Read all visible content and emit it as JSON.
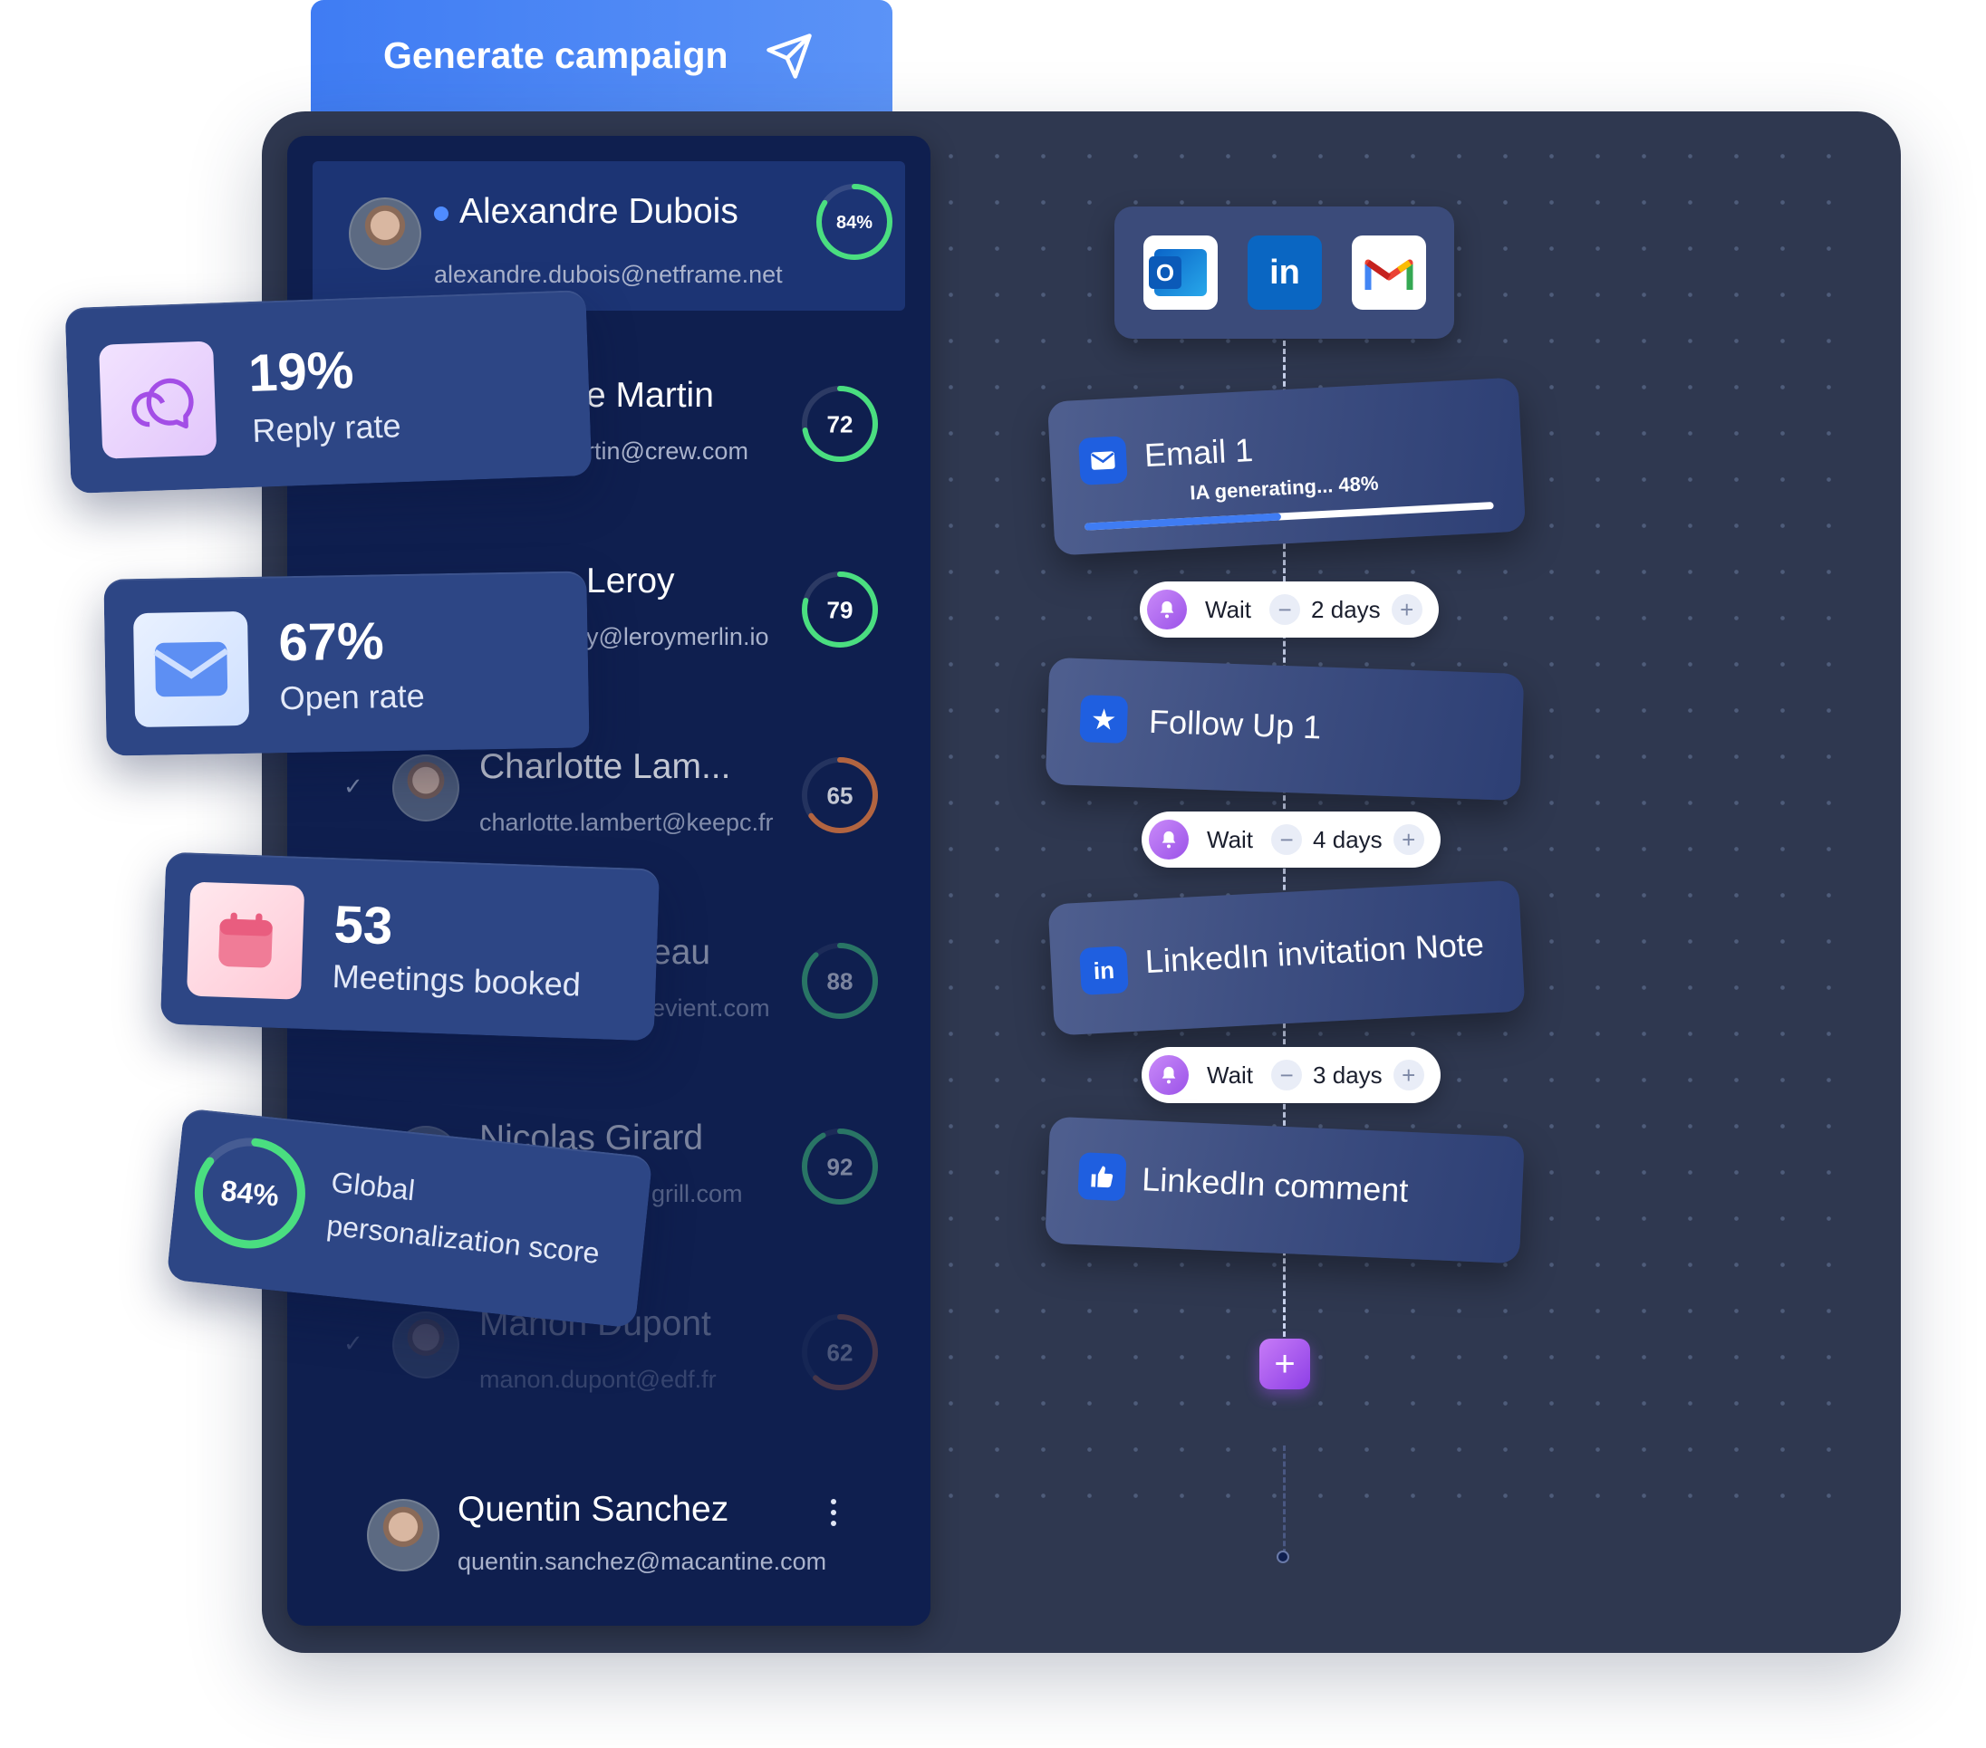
{
  "generate": {
    "label": "Generate campaign",
    "icon": "send-icon"
  },
  "contacts": [
    {
      "name": "Alexandre Dubois",
      "email": "alexandre.dubois@netframe.net",
      "score": "84%",
      "score_value": 84,
      "status": "online"
    },
    {
      "name": "e Martin",
      "email": "rtin@crew.com",
      "score": "72",
      "score_value": 72
    },
    {
      "name": "Leroy",
      "email": "y@leroymerlin.io",
      "score": "79",
      "score_value": 79
    },
    {
      "name": "Charlotte Lam...",
      "email": "charlotte.lambert@keepc.fr",
      "score": "65",
      "score_value": 65
    },
    {
      "name": "eau",
      "email": "evient.com",
      "score": "88",
      "score_value": 88
    },
    {
      "name": "Nicolas Girard",
      "email": "grill.com",
      "score": "92",
      "score_value": 92
    },
    {
      "name": "Manon Dupont",
      "email": "manon.dupont@edf.fr",
      "score": "62",
      "score_value": 62
    }
  ],
  "footer_user": {
    "name": "Quentin Sanchez",
    "email": "quentin.sanchez@macantine.com"
  },
  "stats": {
    "reply": {
      "value": "19%",
      "label": "Reply rate",
      "icon": "chat-bubble-icon"
    },
    "open": {
      "value": "67%",
      "label": "Open rate",
      "icon": "envelope-icon"
    },
    "meetings": {
      "value": "53",
      "label": "Meetings booked",
      "icon": "calendar-icon"
    },
    "personalization": {
      "value": "84%",
      "value_num": 84,
      "line1": "Global",
      "line2": "personalization score"
    }
  },
  "channels": [
    {
      "name": "Outlook",
      "icon": "outlook-icon",
      "glyph": "O"
    },
    {
      "name": "LinkedIn",
      "icon": "linkedin-icon",
      "glyph": "in"
    },
    {
      "name": "Gmail",
      "icon": "gmail-icon",
      "glyph": "M"
    }
  ],
  "workflow": {
    "email1": {
      "title": "Email 1",
      "progress_label": "IA generating... 48%",
      "progress": 0.48
    },
    "wait1": {
      "label": "Wait",
      "value": "2 days"
    },
    "followup": {
      "title": "Follow Up 1"
    },
    "wait2": {
      "label": "Wait",
      "value": "4 days"
    },
    "linkedin_invite": {
      "title": "LinkedIn invitation Note",
      "icon_text": "in"
    },
    "wait3": {
      "label": "Wait",
      "value": "3 days"
    },
    "linkedin_comment": {
      "title": "LinkedIn comment"
    },
    "add_label": "+"
  },
  "colors": {
    "ring_green": "#4ade80",
    "ring_orange": "#e97b3c",
    "accent_blue": "#3f7cf3",
    "panel": "#0f1f4f",
    "card": "#2f3850"
  }
}
